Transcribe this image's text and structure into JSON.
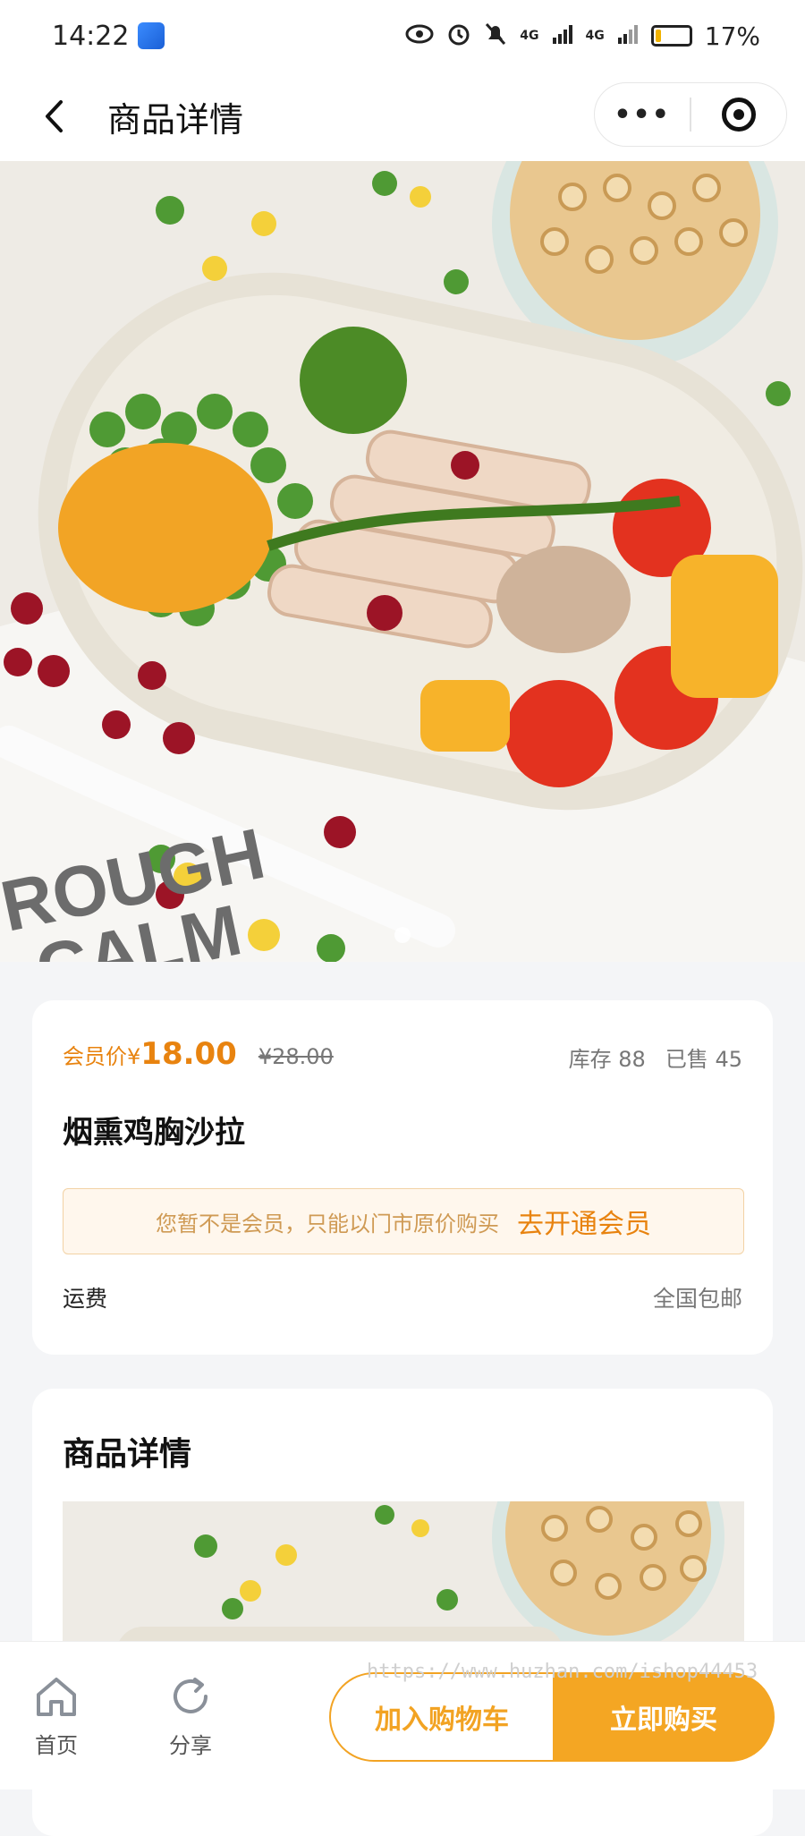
{
  "status_bar": {
    "time": "14:22",
    "network_1": "4G",
    "network_2": "4G",
    "battery": "17%",
    "battery_level": 0.17
  },
  "navbar": {
    "title": "商品详情",
    "more_label": "•••"
  },
  "hero": {
    "image_icon": "salad-photo"
  },
  "product": {
    "member_label": "会员价¥",
    "price": "18.00",
    "original_price": "¥28.00",
    "stock": "库存 88",
    "sold": "已售 45",
    "name": "烟熏鸡胸沙拉",
    "notice_text": "您暂不是会员，只能以门市原价购买",
    "notice_link": "去开通会员",
    "shipping_label": "运费",
    "shipping_value": "全国包邮"
  },
  "detail": {
    "title": "商品详情"
  },
  "bottom_bar": {
    "home_label": "首页",
    "share_label": "分享",
    "cart_button": "加入购物车",
    "buy_button": "立即购买"
  },
  "watermark": "https://www.huzhan.com/ishop44453",
  "colors": {
    "accent": "#e8830f",
    "button": "#f4a623"
  }
}
